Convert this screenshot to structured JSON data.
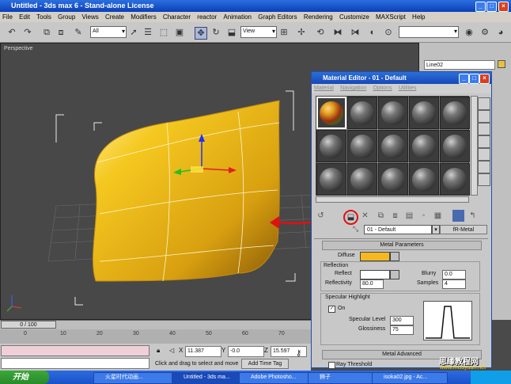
{
  "window": {
    "title": "Untitled - 3ds max 6 - Stand-alone License"
  },
  "menu": [
    "File",
    "Edit",
    "Tools",
    "Group",
    "Views",
    "Create",
    "Modifiers",
    "Character",
    "reactor",
    "Animation",
    "Graph Editors",
    "Rendering",
    "Customize",
    "MAXScript",
    "Help"
  ],
  "toolbar": {
    "selection_filter": "All",
    "reference_coord": "View"
  },
  "viewport": {
    "label": "Perspective"
  },
  "command_panel": {
    "object_name": "Line02"
  },
  "material_editor": {
    "title": "Material Editor - 01 - Default",
    "menu": [
      "Material",
      "Navigation",
      "Options",
      "Utilities"
    ],
    "material_name": "01 - Default",
    "material_type": "fR-Metal",
    "metal_params": {
      "rollout_title": "Metal Parameters",
      "diffuse_label": "Diffuse",
      "diffuse_color": "#f5b820",
      "reflection_label": "Reflection",
      "reflect_label": "Reflect",
      "reflect_color": "#ffffff",
      "reflectivity_label": "Reflectivity",
      "reflectivity_value": "80.0",
      "blurry_label": "Blurry",
      "blurry_value": "0.0",
      "samples_label": "Samples",
      "samples_value": "4"
    },
    "specular": {
      "title": "Specular Highlight",
      "on_label": "On",
      "specular_level_label": "Specular Level",
      "specular_level_value": "300",
      "glossiness_label": "Glossiness",
      "glossiness_value": "75"
    },
    "metal_advanced": {
      "rollout_title": "Metal Advanced",
      "ray_threshold_label": "Ray Threshold"
    }
  },
  "timeline": {
    "slider": "0 / 100",
    "ticks": [
      "0",
      "10",
      "20",
      "30",
      "40",
      "50",
      "60",
      "70"
    ]
  },
  "status": {
    "x_label": "X",
    "x_value": "11.387",
    "y_label": "Y",
    "y_value": "-0.0",
    "z_label": "Z",
    "z_value": "15.597",
    "prompt": "Click and drag to select and move",
    "add_time_tag": "Add Time Tag"
  },
  "taskbar": {
    "start_label": "开始",
    "tasks": [
      "火星时代动画...",
      "Untitled - 3ds ma...",
      "Adobe Photosho...",
      "狮子",
      "isoka02.jpg - Ac..."
    ]
  },
  "watermark": {
    "line1": "思缘教程网",
    "line2": "www.missyuan.net"
  },
  "colors": {
    "object_color": "#e8c040",
    "annotation_arrow": "#e01010"
  }
}
